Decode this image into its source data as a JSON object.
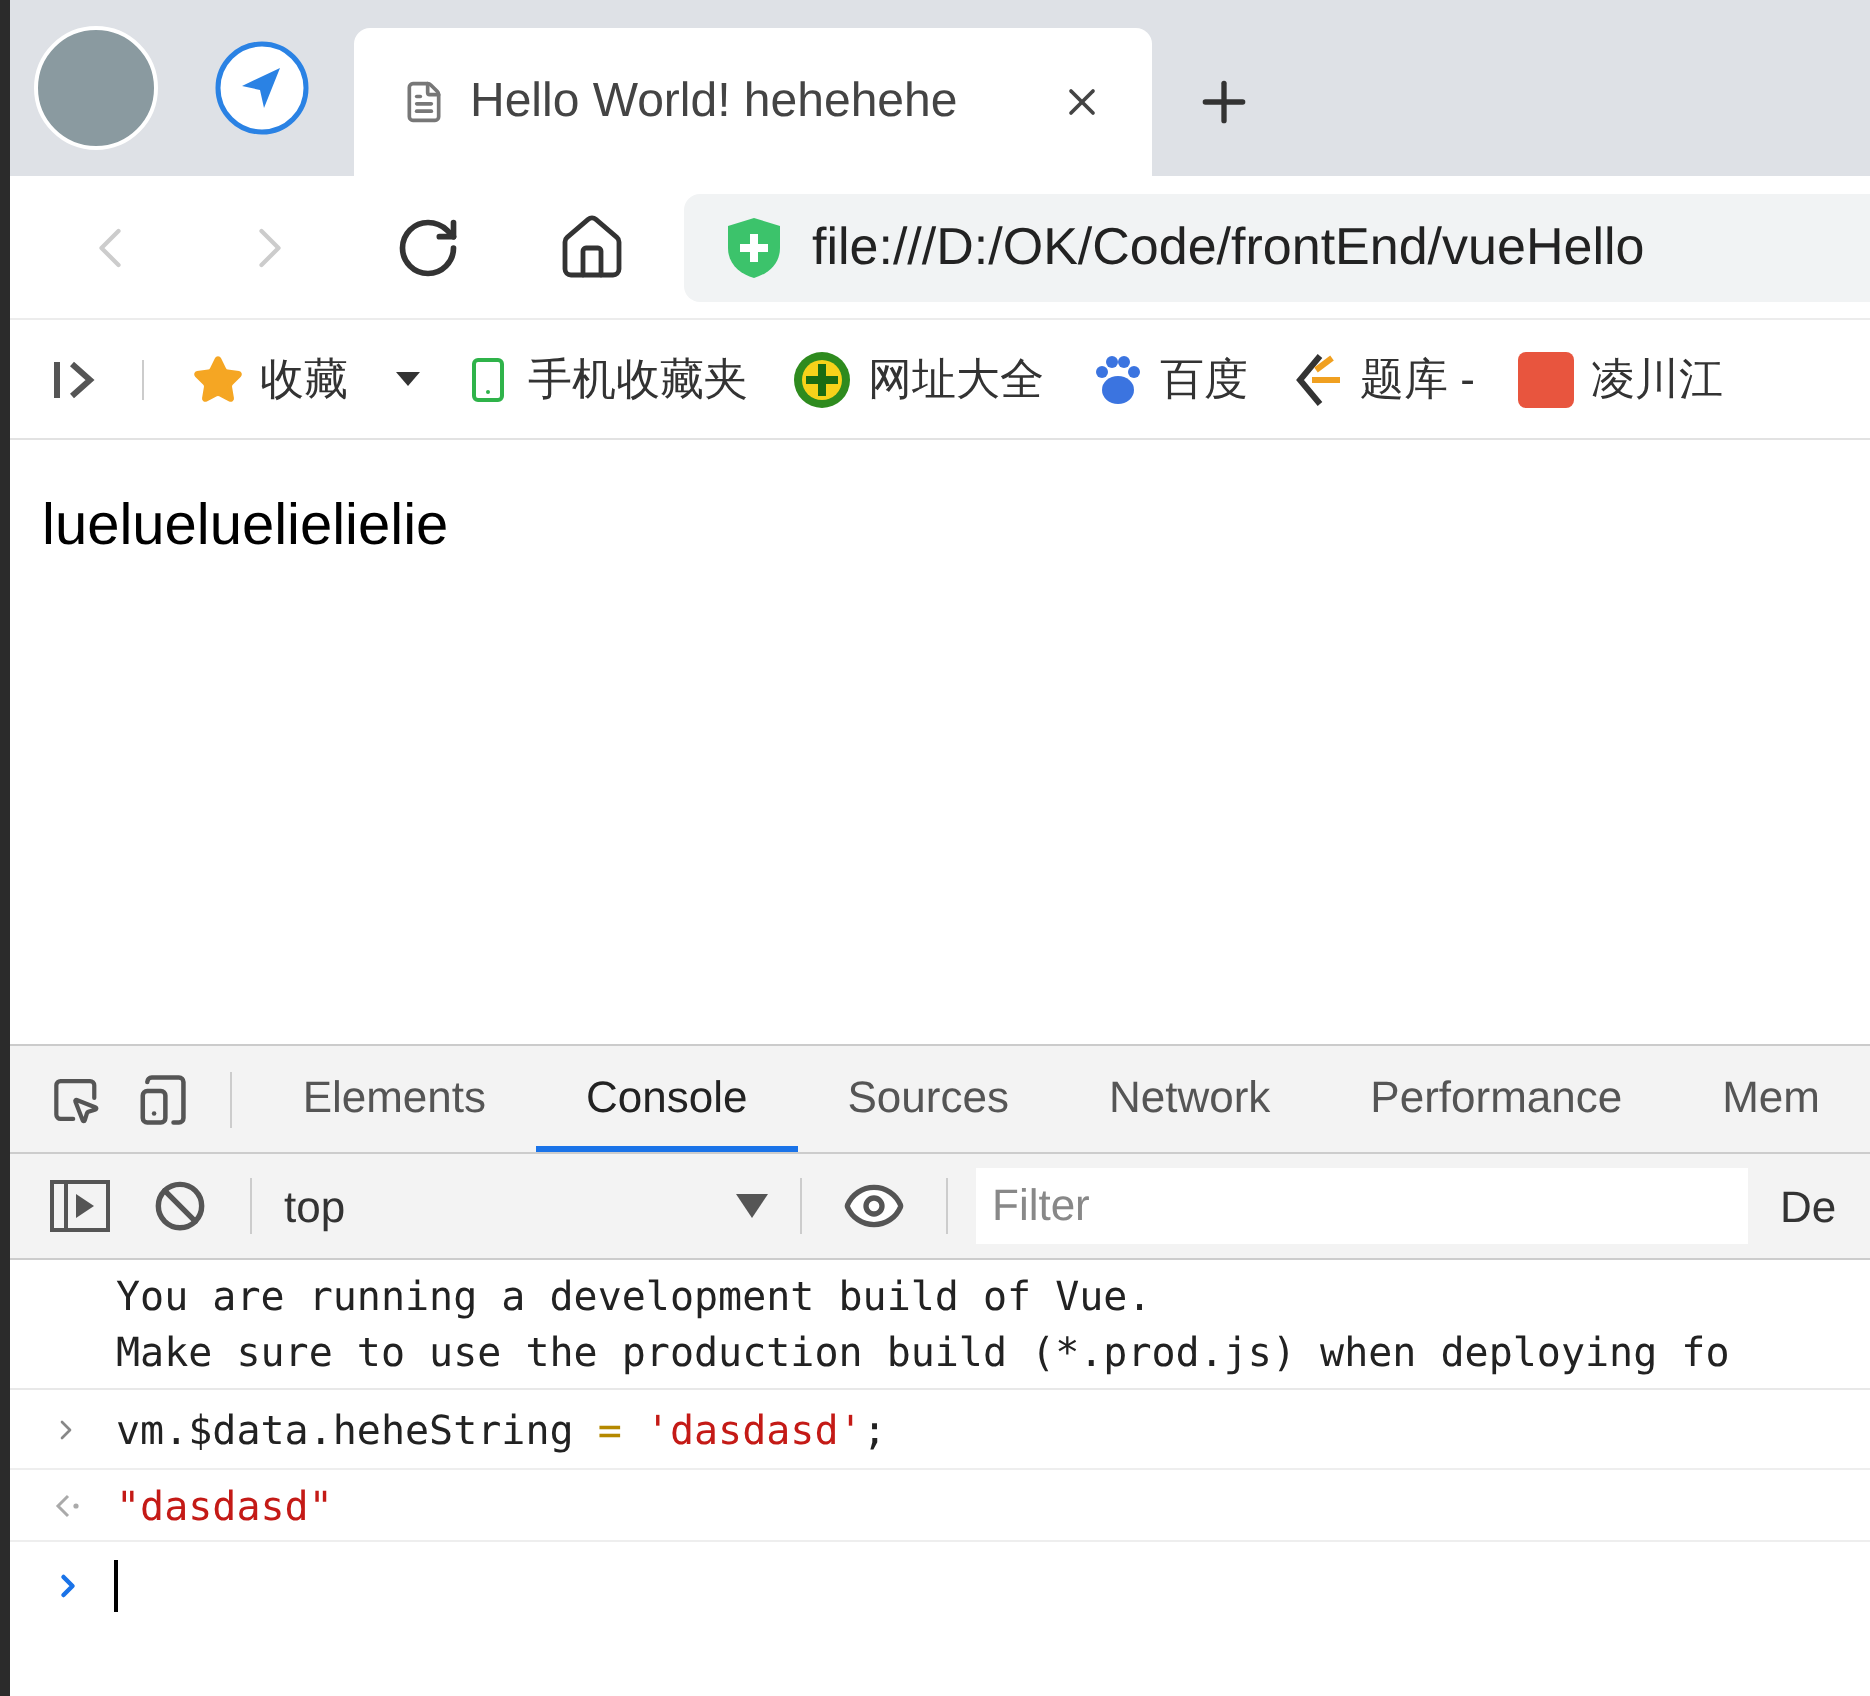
{
  "browser_tabs": [
    {
      "title": "Hello World! hehehehe",
      "selected": true
    }
  ],
  "address_bar": {
    "url": "file:///D:/OK/Code/frontEnd/vueHello"
  },
  "bookmarks": [
    {
      "kind": "star",
      "label": "收藏",
      "dropdown": true
    },
    {
      "kind": "phone",
      "label": "手机收藏夹",
      "dropdown": false
    },
    {
      "kind": "globe",
      "label": "网址大全",
      "dropdown": false
    },
    {
      "kind": "paw",
      "label": "百度",
      "dropdown": false
    },
    {
      "kind": "book",
      "label": "题库 -",
      "dropdown": false
    },
    {
      "kind": "app",
      "label": "凌川江",
      "dropdown": false
    }
  ],
  "page_text": "luelueluelielielie",
  "devtools": {
    "tabs": [
      {
        "label": "Elements",
        "selected": false
      },
      {
        "label": "Console",
        "selected": true
      },
      {
        "label": "Sources",
        "selected": false
      },
      {
        "label": "Network",
        "selected": false
      },
      {
        "label": "Performance",
        "selected": false
      },
      {
        "label": "Mem",
        "selected": false
      }
    ],
    "context": "top",
    "filter_placeholder": "Filter",
    "levels_label": "De",
    "messages": [
      {
        "kind": "log",
        "lines": [
          "You are running a development build of Vue.",
          "Make sure to use the production build (*.prod.js) when deploying fo"
        ]
      },
      {
        "kind": "input",
        "parts": [
          {
            "kind": "code",
            "text": "vm.$data.heheString"
          },
          {
            "kind": "operator",
            "text": " = "
          },
          {
            "kind": "string",
            "text": "'dasdasd'"
          },
          {
            "kind": "code",
            "text": ";"
          }
        ]
      },
      {
        "kind": "result",
        "parts": [
          {
            "kind": "string",
            "text": "\"dasdasd\""
          }
        ]
      },
      {
        "kind": "prompt"
      }
    ]
  }
}
